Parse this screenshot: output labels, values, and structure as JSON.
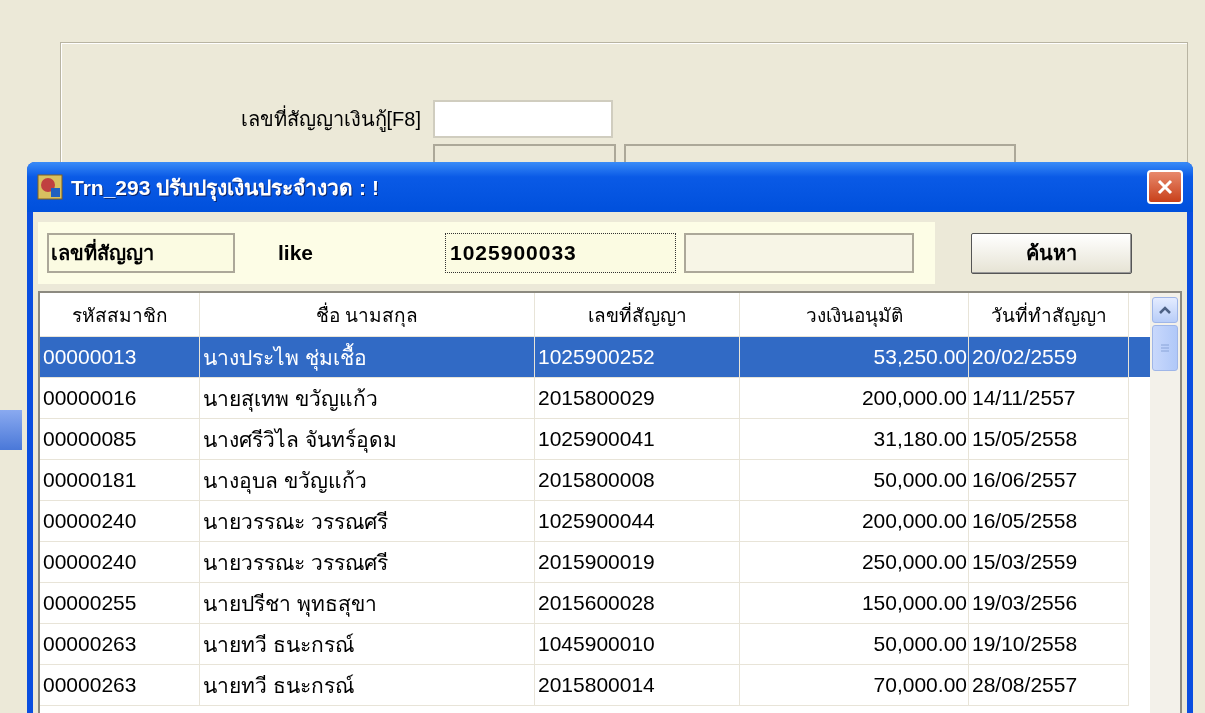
{
  "form": {
    "contract_label": "เลขที่สัญญาเงินกู้[F8]"
  },
  "dialog": {
    "title": "Trn_293 ปรับปรุงเงินประจำงวด : !",
    "search": {
      "field": "เลขที่สัญญา",
      "operator": "like",
      "value": "1025900033",
      "button": "ค้นหา"
    },
    "table": {
      "columns": [
        "รหัสสมาชิก",
        "ชื่อ นามสกุล",
        "เลขที่สัญญา",
        "วงเงินอนุมัติ",
        "วันที่ทำสัญญา"
      ],
      "rows": [
        {
          "selected": true,
          "cells": [
            "00000013",
            "นางประไพ ชุ่มเชื้อ",
            "1025900252",
            "53,250.00",
            "20/02/2559"
          ]
        },
        {
          "selected": false,
          "cells": [
            "00000016",
            "นายสุเทพ ขวัญแก้ว",
            "2015800029",
            "200,000.00",
            "14/11/2557"
          ]
        },
        {
          "selected": false,
          "cells": [
            "00000085",
            "นางศรีวิไล จันทร์อุดม",
            "1025900041",
            "31,180.00",
            "15/05/2558"
          ]
        },
        {
          "selected": false,
          "cells": [
            "00000181",
            "นางอุบล ขวัญแก้ว",
            "2015800008",
            "50,000.00",
            "16/06/2557"
          ]
        },
        {
          "selected": false,
          "cells": [
            "00000240",
            "นายวรรณะ วรรณศรี",
            "1025900044",
            "200,000.00",
            "16/05/2558"
          ]
        },
        {
          "selected": false,
          "cells": [
            "00000240",
            "นายวรรณะ วรรณศรี",
            "2015900019",
            "250,000.00",
            "15/03/2559"
          ]
        },
        {
          "selected": false,
          "cells": [
            "00000255",
            "นายปรีชา พุทธสุขา",
            "2015600028",
            "150,000.00",
            "19/03/2556"
          ]
        },
        {
          "selected": false,
          "cells": [
            "00000263",
            "นายทวี ธนะกรณ์",
            "1045900010",
            "50,000.00",
            "19/10/2558"
          ]
        },
        {
          "selected": false,
          "cells": [
            "00000263",
            "นายทวี ธนะกรณ์",
            "2015800014",
            "70,000.00",
            "28/08/2557"
          ]
        }
      ]
    }
  }
}
